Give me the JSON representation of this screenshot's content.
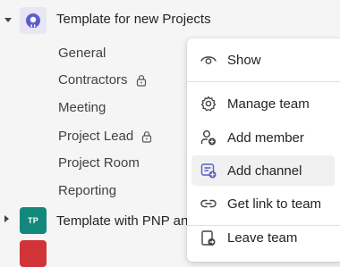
{
  "teams": [
    {
      "name": "Template for new Projects",
      "expanded": true,
      "avatar_icon": "team-logo-icon"
    },
    {
      "name": "Template with PNP and",
      "expanded": false,
      "avatar_initials": "TP"
    }
  ],
  "channels": [
    {
      "label": "General",
      "locked": false
    },
    {
      "label": "Contractors",
      "locked": true
    },
    {
      "label": "Meeting",
      "locked": false
    },
    {
      "label": "Project Lead",
      "locked": true
    },
    {
      "label": "Project Room",
      "locked": false
    },
    {
      "label": "Reporting",
      "locked": false
    }
  ],
  "context_menu": {
    "show": "Show",
    "manage_team": "Manage team",
    "add_member": "Add member",
    "add_channel": "Add channel",
    "get_link": "Get link to team",
    "leave_team": "Leave team"
  },
  "colors": {
    "accent": "#5b5fc7",
    "tp_avatar": "#12887a",
    "third_avatar": "#d13438"
  }
}
